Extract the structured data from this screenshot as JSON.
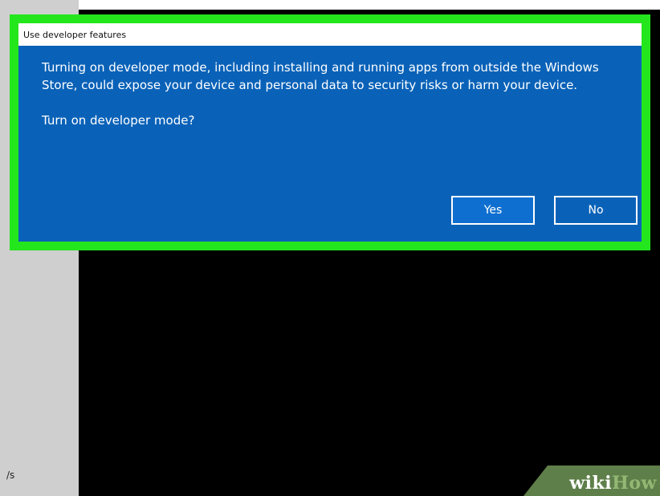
{
  "dialog": {
    "title": "Use developer features",
    "message": "Turning on developer mode, including installing and running apps from outside the Windows Store, could expose your device and personal data to security risks or harm your device.",
    "question": "Turn on developer mode?",
    "yes_label": "Yes",
    "no_label": "No"
  },
  "background": {
    "left_panel_text": "/s"
  },
  "watermark": {
    "part1": "wiki",
    "part2": "How"
  },
  "colors": {
    "dialog_blue": "#0a62b8",
    "highlight_green": "#24e61c",
    "background_black": "#000000",
    "sidebar_gray": "#cfcfcf"
  }
}
